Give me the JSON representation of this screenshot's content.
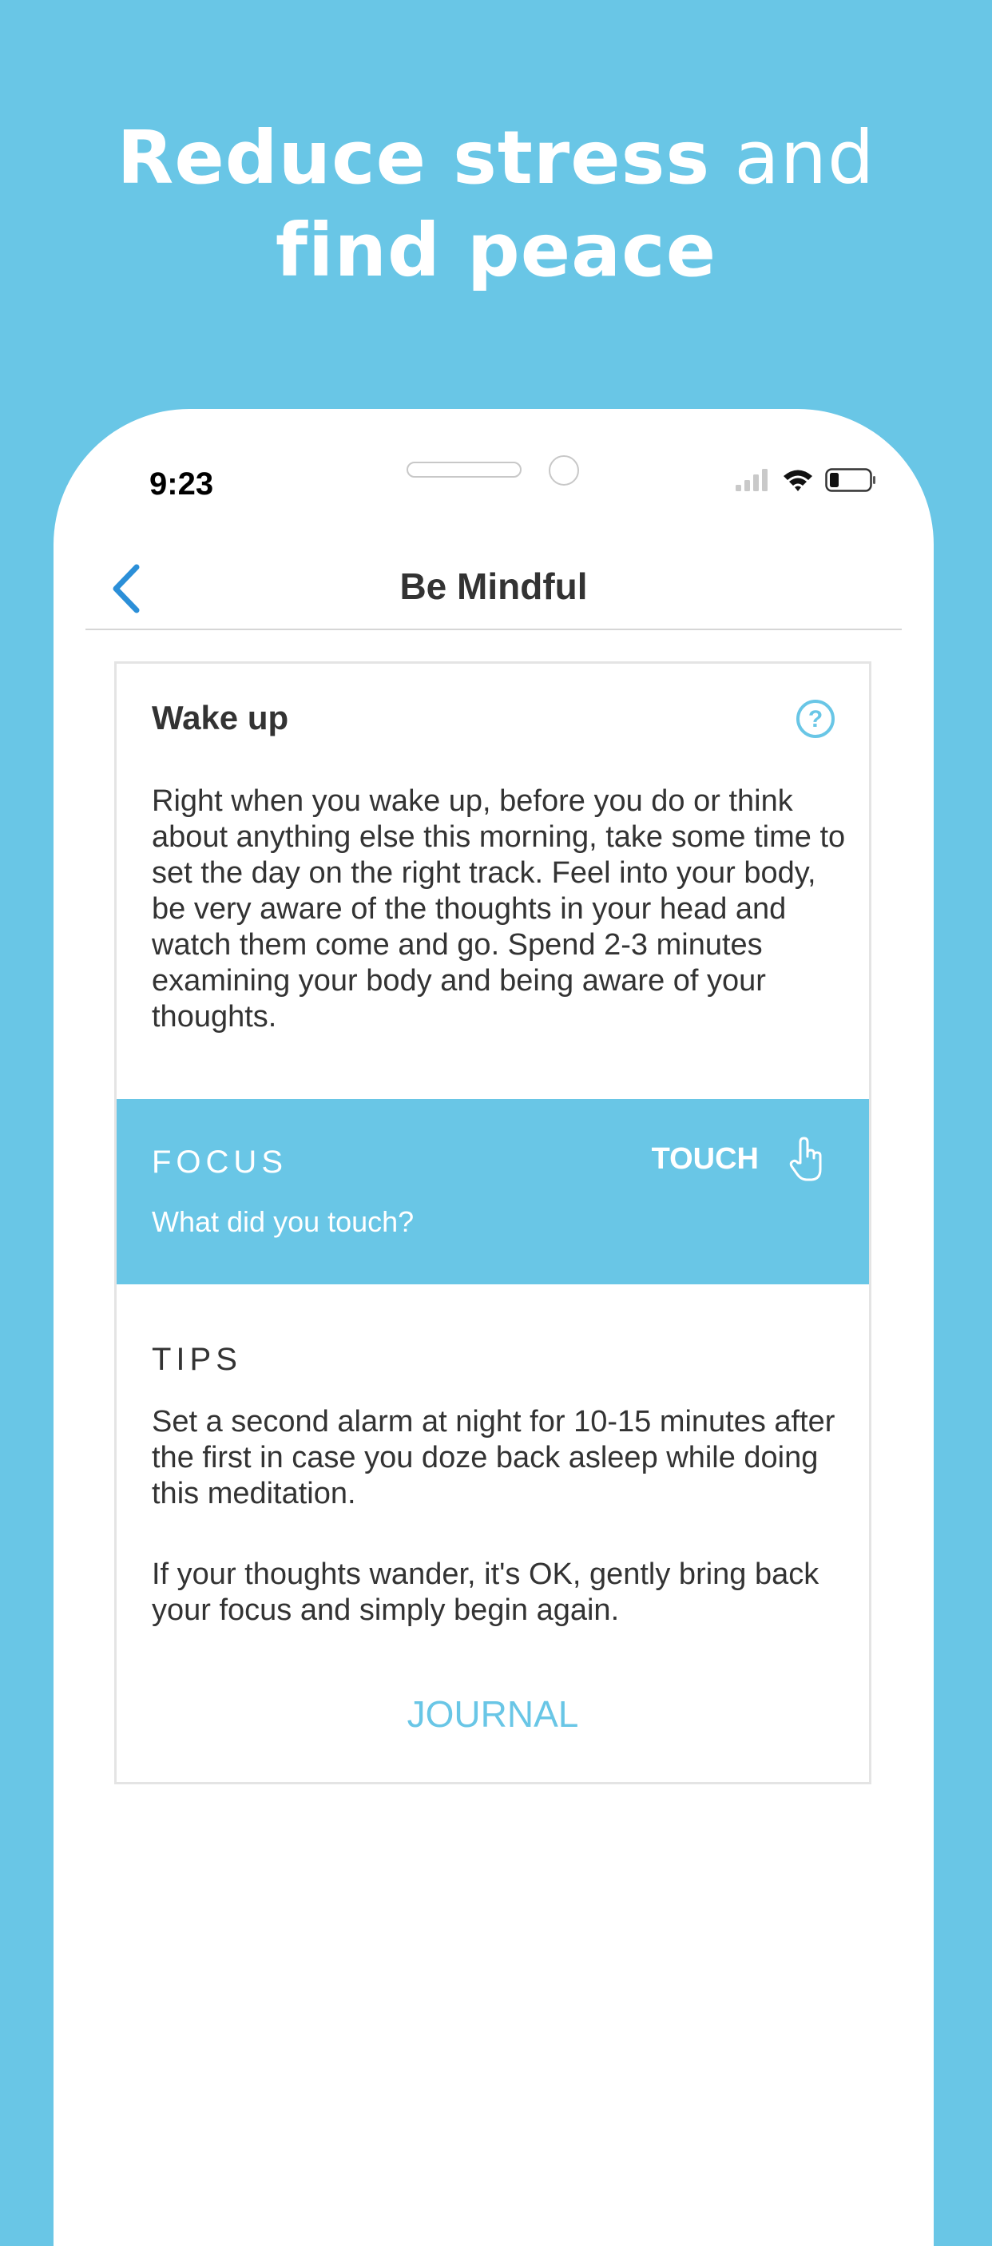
{
  "promo": {
    "headline_bold_1": "Reduce stress",
    "headline_light": "and",
    "headline_bold_2": "find peace"
  },
  "status_bar": {
    "time": "9:23"
  },
  "nav": {
    "title": "Be Mindful"
  },
  "card": {
    "title": "Wake up",
    "body": "Right when you wake up, before you do or think about anything else this morning, take some time to set the day on the right track. Feel into your body, be very aware of the thoughts in your head and watch them come and go. Spend 2-3 minutes examining your body and being aware of your thoughts.",
    "focus": {
      "label": "FOCUS",
      "type": "TOUCH",
      "question": "What did you touch?"
    },
    "tips": {
      "label": "TIPS",
      "items": [
        "Set a second alarm at night for 10-15 minutes after the first in case you doze back asleep while doing this meditation.",
        "If your thoughts wander, it's OK, gently bring back your focus and simply begin again."
      ]
    },
    "journal_label": "JOURNAL"
  },
  "colors": {
    "accent": "#69c6e6",
    "back_arrow": "#2b8fd8",
    "text": "#333333"
  }
}
